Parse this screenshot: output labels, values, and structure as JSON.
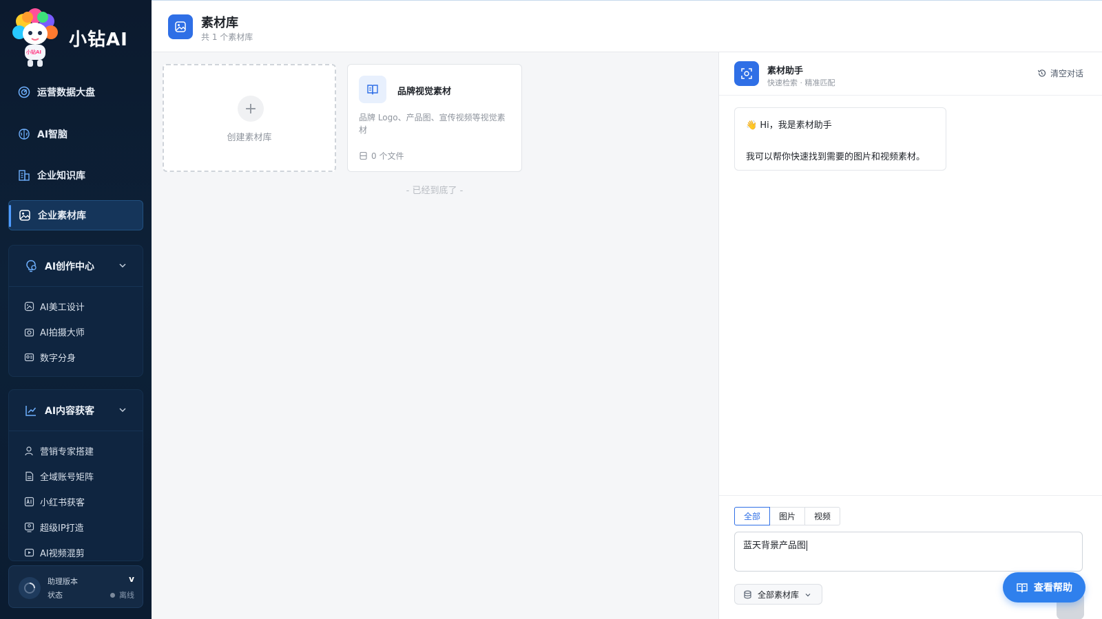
{
  "brand": {
    "name": "小钻AI",
    "logo_badge": "小钻AI"
  },
  "nav": {
    "items": [
      {
        "label": "运营数据大盘",
        "icon": "dashboard-icon"
      },
      {
        "label": "AI智脑",
        "icon": "brain-icon"
      },
      {
        "label": "企业知识库",
        "icon": "building-icon"
      },
      {
        "label": "企业素材库",
        "icon": "image-icon",
        "active": true
      }
    ]
  },
  "groups": [
    {
      "title": "AI创作中心",
      "icon": "bulb-icon",
      "items": [
        "AI美工设计",
        "AI拍摄大师",
        "数字分身"
      ]
    },
    {
      "title": "AI内容获客",
      "icon": "chart-icon",
      "items": [
        "营销专家搭建",
        "全域账号矩阵",
        "小红书获客",
        "超级IP打造",
        "AI视频混剪"
      ]
    }
  ],
  "version": {
    "title": "助理版本",
    "letter": "v",
    "status_label": "状态",
    "status_value": "离线"
  },
  "header": {
    "title": "素材库",
    "subtitle": "共 1 个素材库"
  },
  "main": {
    "create_label": "创建素材库",
    "library": {
      "title": "品牌视觉素材",
      "description": "品牌 Logo、产品图、宣传视频等视觉素材",
      "count": "0 个文件"
    },
    "end_text": "- 已经到底了 -"
  },
  "assistant": {
    "title": "素材助手",
    "subtitle": "快速检索 · 精准匹配",
    "clear_label": "清空对话",
    "greeting": "Hi，我是素材助手",
    "greeting_emoji": "👋",
    "intro": "我可以帮你快速找到需要的图片和视频素材。",
    "tabs": [
      "全部",
      "图片",
      "视频"
    ],
    "active_tab": 0,
    "input_value": "蓝天背景产品图",
    "library_select": "全部素材库"
  },
  "help_button": "查看帮助",
  "colors": {
    "accent": "#2f6fe6",
    "sidebar_bg": "#0c1a2e",
    "help_button": "#2f80ed"
  }
}
